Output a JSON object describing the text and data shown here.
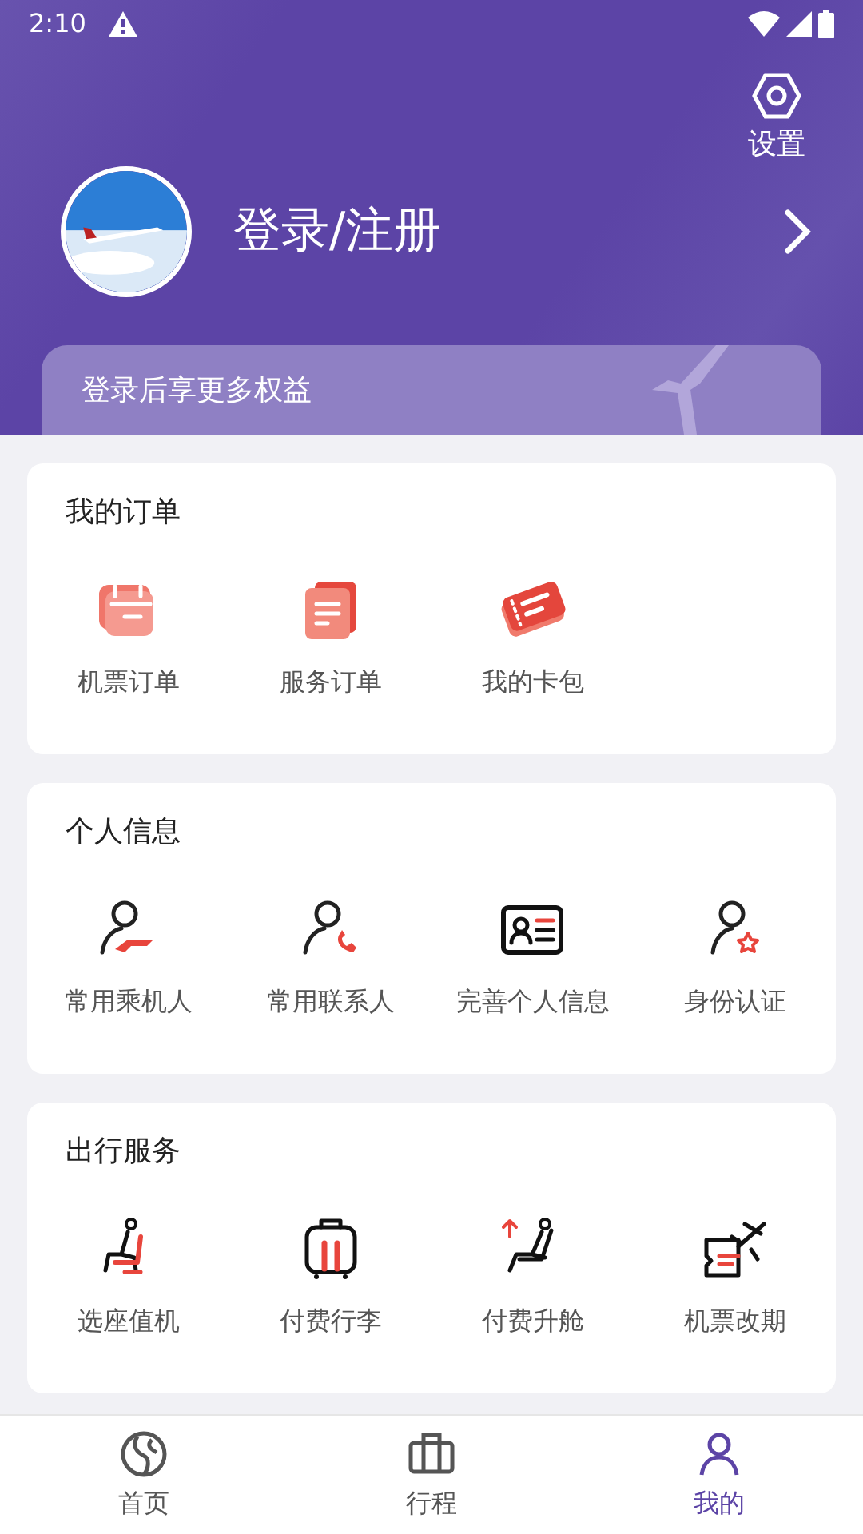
{
  "status_bar": {
    "time": "2:10"
  },
  "header": {
    "settings_label": "设置",
    "login_label": "登录/注册",
    "benefits_text": "登录后享更多权益"
  },
  "sections": [
    {
      "title": "我的订单",
      "items": [
        {
          "label": "机票订单",
          "kind": "ticket-order"
        },
        {
          "label": "服务订单",
          "kind": "service-order"
        },
        {
          "label": "我的卡包",
          "kind": "card-wallet"
        }
      ]
    },
    {
      "title": "个人信息",
      "items": [
        {
          "label": "常用乘机人",
          "kind": "passenger"
        },
        {
          "label": "常用联系人",
          "kind": "contact"
        },
        {
          "label": "完善个人信息",
          "kind": "id-card"
        },
        {
          "label": "身份认证",
          "kind": "verify"
        }
      ]
    },
    {
      "title": "出行服务",
      "items": [
        {
          "label": "选座值机",
          "kind": "seat"
        },
        {
          "label": "付费行李",
          "kind": "luggage"
        },
        {
          "label": "付费升舱",
          "kind": "upgrade"
        },
        {
          "label": "机票改期",
          "kind": "reschedule"
        }
      ]
    }
  ],
  "tab_bar": [
    {
      "label": "首页",
      "kind": "home",
      "selected": false
    },
    {
      "label": "行程",
      "kind": "trips",
      "selected": false
    },
    {
      "label": "我的",
      "kind": "me",
      "selected": true
    }
  ]
}
